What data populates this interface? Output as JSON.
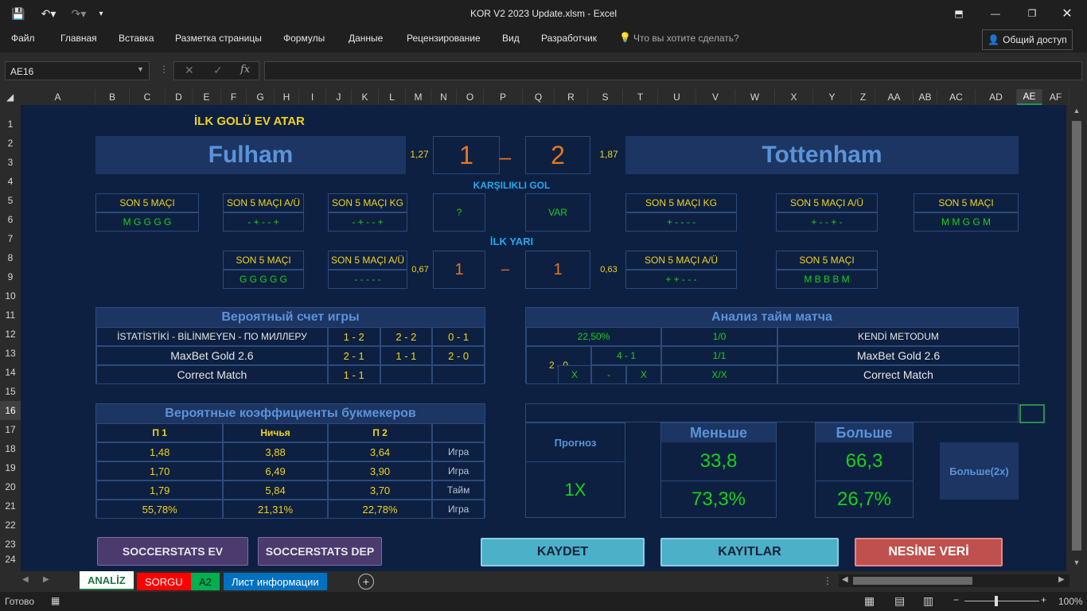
{
  "window": {
    "title": "KOR V2 2023  Update.xlsm - Excel",
    "share": "Общий доступ",
    "tell_me": "Что вы хотите сделать?"
  },
  "ribbon_tabs": [
    "Файл",
    "Главная",
    "Вставка",
    "Разметка страницы",
    "Формулы",
    "Данные",
    "Рецензирование",
    "Вид",
    "Разработчик"
  ],
  "name_box": "AE16",
  "columns": [
    "A",
    "B",
    "C",
    "D",
    "E",
    "F",
    "G",
    "H",
    "I",
    "J",
    "K",
    "L",
    "M",
    "N",
    "O",
    "P",
    "Q",
    "R",
    "S",
    "T",
    "U",
    "V",
    "W",
    "X",
    "Y",
    "Z",
    "AA",
    "AB",
    "AC",
    "AD",
    "AE",
    "AF"
  ],
  "rows": [
    "1",
    "2",
    "3",
    "4",
    "5",
    "6",
    "7",
    "8",
    "9",
    "10",
    "11",
    "12",
    "13",
    "14",
    "15",
    "16",
    "17",
    "18",
    "19",
    "20",
    "21",
    "22",
    "23",
    "24"
  ],
  "header": {
    "first_goal": "İLK GOLÜ EV ATAR",
    "home": "Fulham",
    "away": "Tottenham",
    "home_odds": "1,27",
    "away_odds": "1,87",
    "home_score": "1",
    "dash": "–",
    "away_score": "2"
  },
  "kg": {
    "title": "KARŞILIKLI GOL",
    "q": "?",
    "var": "VAR"
  },
  "home_stats": [
    {
      "label": "SON 5 MAÇI",
      "value": "M G G G G"
    },
    {
      "label": "SON 5 MAÇI A/Ü",
      "value": "- + - - +"
    },
    {
      "label": "SON 5 MAÇI KG",
      "value": "- + - - +"
    }
  ],
  "away_stats": [
    {
      "label": "SON 5 MAÇI KG",
      "value": "+ - - - -"
    },
    {
      "label": "SON 5 MAÇI A/Ü",
      "value": "+ - - + -"
    },
    {
      "label": "SON 5 MAÇI",
      "value": "M M G G M"
    }
  ],
  "half": {
    "title": "İLK YARI",
    "home_odds": "0,67",
    "away_odds": "0,63",
    "home_score": "1",
    "dash": "–",
    "away_score": "1"
  },
  "half_home": [
    {
      "label": "SON 5 MAÇI",
      "value": "G G G G G"
    },
    {
      "label": "SON 5 MAÇI A/Ü",
      "value": "- - - - -"
    }
  ],
  "half_away": [
    {
      "label": "SON 5 MAÇI A/Ü",
      "value": "+ + - - -"
    },
    {
      "label": "SON 5 MAÇI",
      "value": "M B B B M"
    }
  ],
  "prob_score": {
    "title": "Вероятный счет игры",
    "rows": [
      {
        "label": "İSTATİSTİKİ - BİLİNMEYEN - ПО МИЛЛЕРУ",
        "v": [
          "1 - 2",
          "2 - 2",
          "0 - 1"
        ]
      },
      {
        "label": "MaxBet Gold 2.6",
        "v": [
          "2 - 1",
          "1 - 1",
          "2 - 0"
        ]
      },
      {
        "label": "Correct Match",
        "v": [
          "1 - 1",
          "",
          ""
        ]
      }
    ]
  },
  "half_analysis": {
    "title": "Анализ тайм матча",
    "pct": "22,50%",
    "r1": "1/0",
    "m1": "KENDİ METODUM",
    "score_a": "2 - 0",
    "score_b": "4 - 1",
    "r2": "1/1",
    "m2": "MaxBet Gold 2.6",
    "x1": "X",
    "xd": "-",
    "x2": "X",
    "r3": "X/X",
    "m3": "Correct Match"
  },
  "bookmaker": {
    "title": "Вероятные коэффициенты букмекеров",
    "headers": [
      "П 1",
      "Ничья",
      "П 2"
    ],
    "rows": [
      {
        "v": [
          "1,48",
          "3,88",
          "3,64"
        ],
        "t": "Игра"
      },
      {
        "v": [
          "1,70",
          "6,49",
          "3,90"
        ],
        "t": "Игра"
      },
      {
        "v": [
          "1,79",
          "5,84",
          "3,70"
        ],
        "t": "Тайм"
      },
      {
        "v": [
          "55,78%",
          "21,31%",
          "22,78%"
        ],
        "t": "Игра"
      }
    ]
  },
  "forecast": {
    "label": "Прогноз",
    "value": "1X",
    "under_label": "Меньше",
    "under_val": "33,8",
    "under_pct": "73,3%",
    "over_label": "Больше",
    "over_val": "66,3",
    "over_pct": "26,7%",
    "tip": "Больше(2x)"
  },
  "buttons": {
    "ss_ev": "SOCCERSTATS EV",
    "ss_dep": "SOCCERSTATS DEP",
    "kaydet": "KAYDET",
    "kayitlar": "KAYITLAR",
    "nesine": "NESİNE VERİ"
  },
  "sheets": [
    "ANALİZ",
    "SORGU",
    "A2",
    "Лист информации"
  ],
  "status": {
    "ready": "Готово",
    "zoom": "100%"
  }
}
